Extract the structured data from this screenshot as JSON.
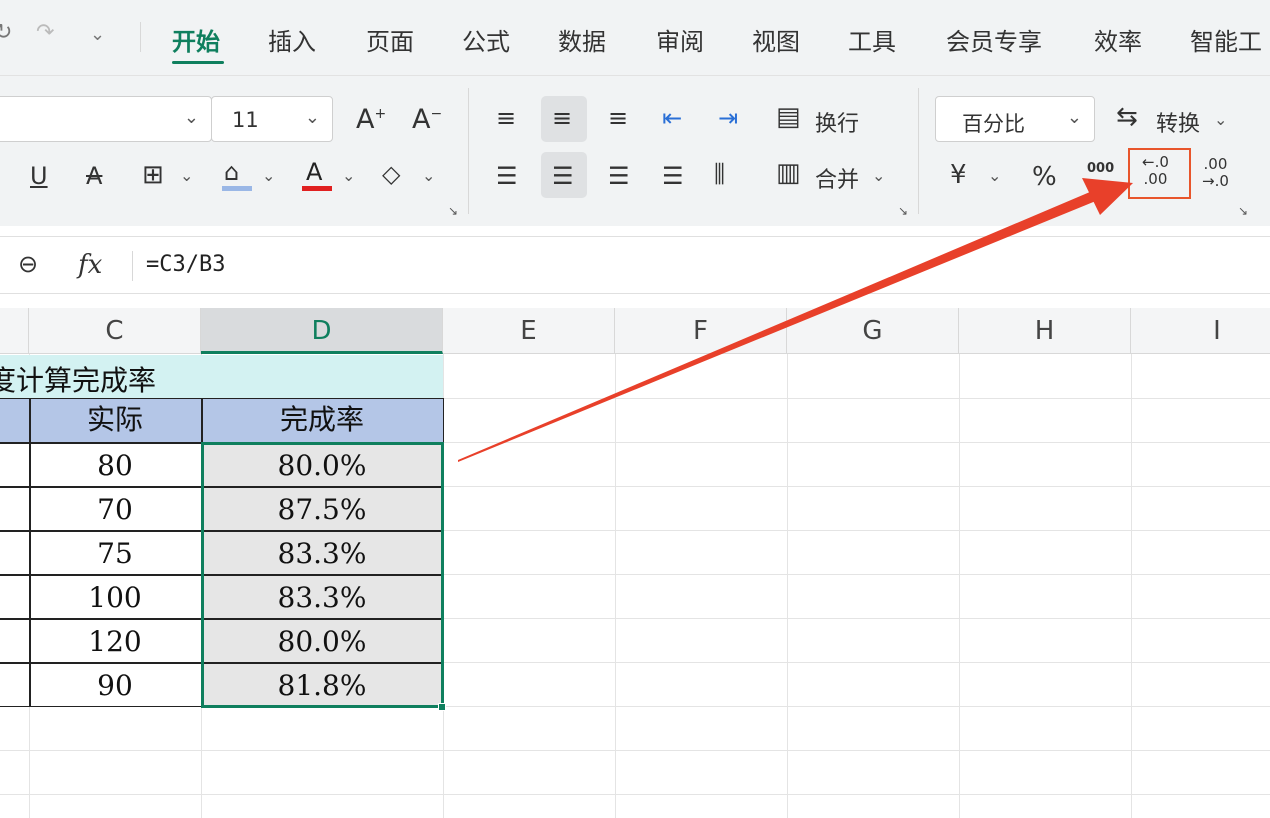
{
  "menu": {
    "tabs": [
      "开始",
      "插入",
      "页面",
      "公式",
      "数据",
      "审阅",
      "视图",
      "工具",
      "会员专享",
      "效率",
      "智能工"
    ],
    "active_tab": "开始"
  },
  "ribbon": {
    "font_size": "11",
    "wrap_label": "换行",
    "merge_label": "合并",
    "number_format": "百分比",
    "convert_label": "转换",
    "percent_symbol": "%",
    "currency_symbol": "¥",
    "thousands_symbol": "000"
  },
  "formula_bar": {
    "fx_label": "fx",
    "formula": "=C3/B3"
  },
  "sheet": {
    "columns": [
      "C",
      "D",
      "E",
      "F",
      "G",
      "H",
      "I"
    ],
    "selected_column": "D",
    "title_fragment": "度计算完成率",
    "headers": [
      "实际",
      "完成率"
    ],
    "rows": [
      {
        "actual": "80",
        "rate": "80.0%"
      },
      {
        "actual": "70",
        "rate": "87.5%"
      },
      {
        "actual": "75",
        "rate": "83.3%"
      },
      {
        "actual": "100",
        "rate": "83.3%"
      },
      {
        "actual": "120",
        "rate": "80.0%"
      },
      {
        "actual": "90",
        "rate": "81.8%"
      }
    ]
  },
  "colors": {
    "accent": "#0f7f5e",
    "title_fill": "#d3f2f2",
    "header_fill": "#b4c6e7",
    "selection_fill": "#e6e6e6",
    "arrow": "#e8402a"
  }
}
